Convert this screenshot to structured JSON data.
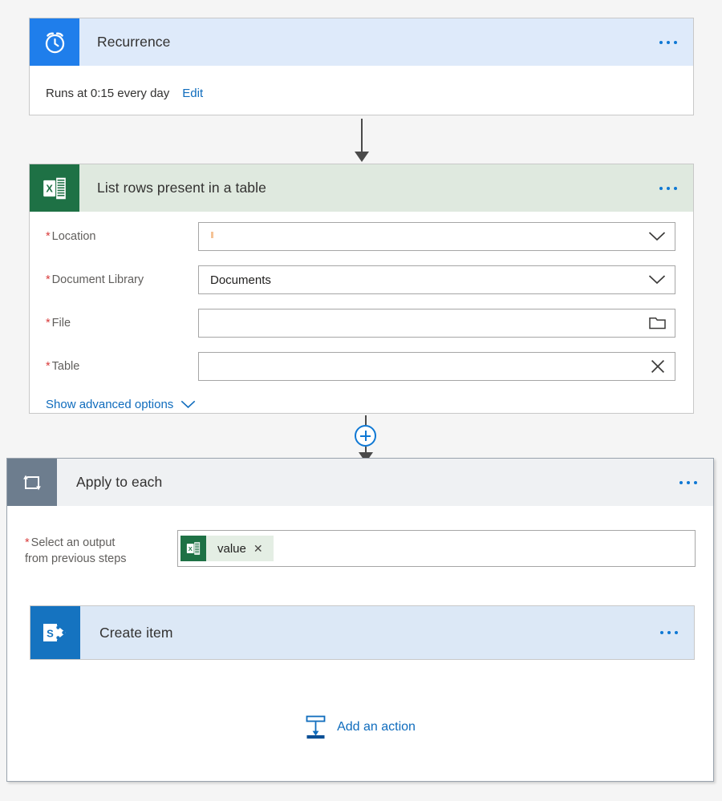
{
  "canvas": {
    "background_color": "#f5f5f5"
  },
  "recurrence": {
    "title": "Recurrence",
    "icon": "alarm-clock-icon",
    "header_color": "#deeafa",
    "icon_tile_color": "#1f7eeb",
    "schedule_text": "Runs at 0:15 every day",
    "edit_label": "Edit",
    "menu": "more-options-icon"
  },
  "excel_action": {
    "title": "List rows present in a table",
    "icon": "excel-icon",
    "header_color": "#dfe9df",
    "icon_tile_color": "#1e7145",
    "menu": "more-options-icon",
    "fields": [
      {
        "label": "Location",
        "required": true,
        "value": "",
        "control": "chevron-down-icon"
      },
      {
        "label": "Document Library",
        "required": true,
        "value": "Documents",
        "control": "chevron-down-icon"
      },
      {
        "label": "File",
        "required": true,
        "value": "",
        "control": "folder-picker-icon"
      },
      {
        "label": "Table",
        "required": true,
        "value": "",
        "control": "clear-x-icon"
      }
    ],
    "advanced_options_label": "Show advanced options",
    "advanced_options_icon": "chevron-down-icon"
  },
  "apply_to_each": {
    "title": "Apply to each",
    "icon": "loop-icon",
    "header_color": "#eff1f3",
    "icon_tile_color": "#6d7d8e",
    "menu": "more-options-icon",
    "output_field": {
      "label_line1": "Select an output",
      "label_line2": "from previous steps",
      "required": true,
      "token": {
        "label": "value",
        "icon": "excel-icon",
        "remove_icon": "token-remove-icon",
        "background_color": "#e4eee4"
      }
    },
    "create_item": {
      "title": "Create item",
      "icon": "sharepoint-icon",
      "header_color": "#dce8f6",
      "icon_tile_color": "#1573c0",
      "menu": "more-options-icon"
    },
    "add_action": {
      "label": "Add an action",
      "icon": "add-action-icon",
      "color": "#0f6cbd"
    }
  },
  "connectors": {
    "trigger_to_excel": "arrow-down",
    "excel_to_loop": "insert-new-step-plus"
  }
}
